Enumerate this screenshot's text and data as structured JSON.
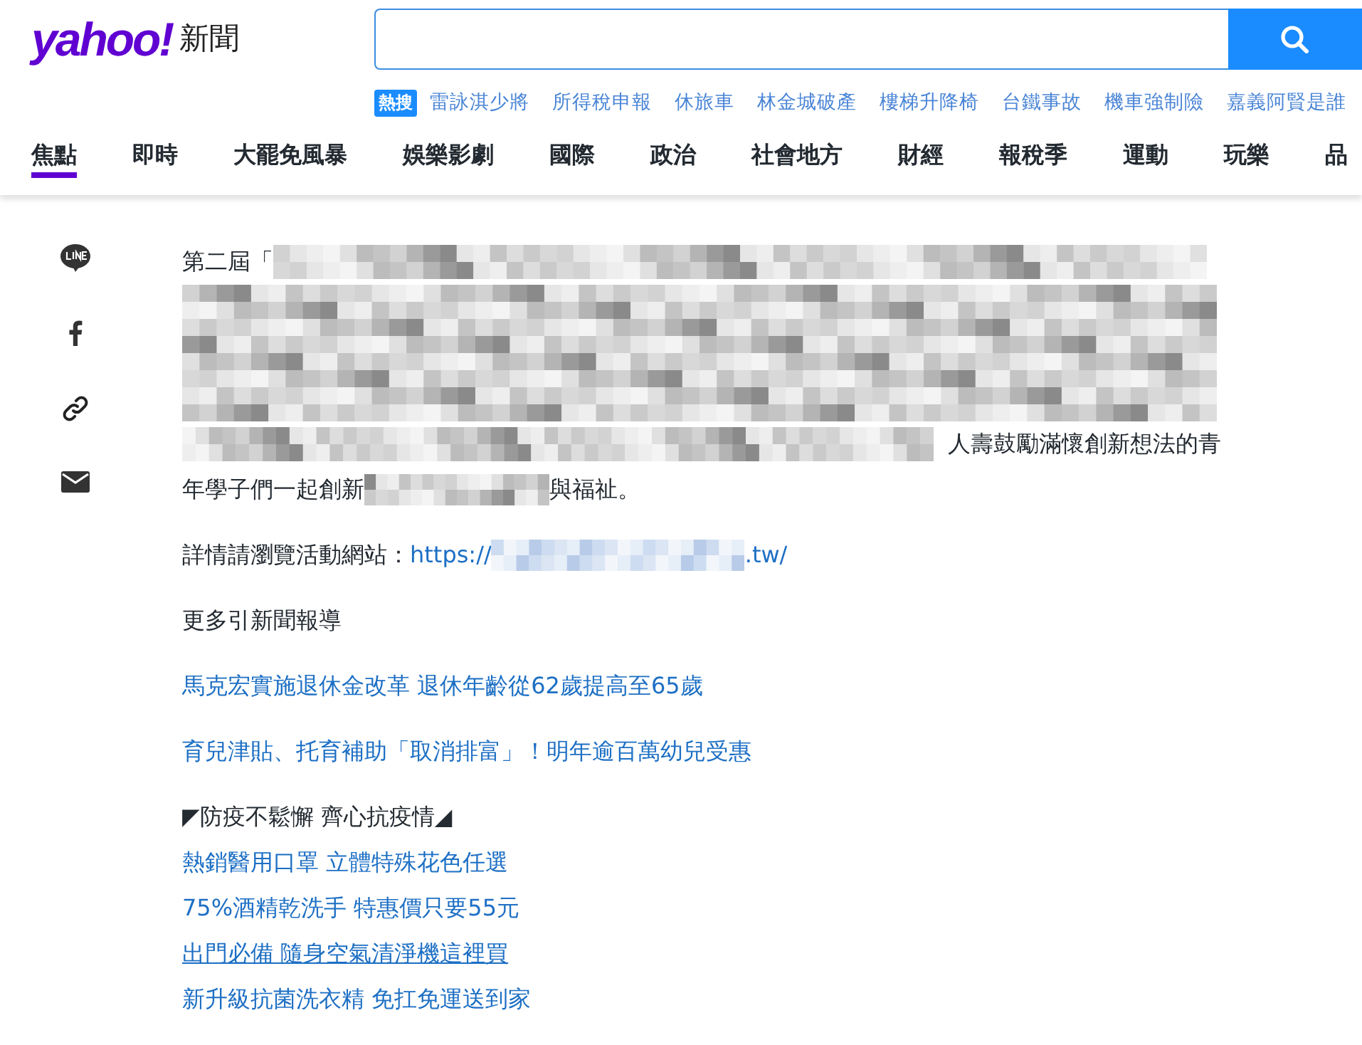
{
  "logo": {
    "brand": "yahoo!",
    "section": "新聞"
  },
  "trending": {
    "label": "熱搜",
    "items": [
      "雷詠淇少將",
      "所得稅申報",
      "休旅車",
      "林金城破產",
      "樓梯升降椅",
      "台鐵事故",
      "機車強制險",
      "嘉義阿賢是誰"
    ]
  },
  "nav": [
    {
      "label": "焦點",
      "selected": true
    },
    {
      "label": "即時",
      "selected": false
    },
    {
      "label": "大罷免風暴",
      "selected": false
    },
    {
      "label": "娛樂影劇",
      "selected": false
    },
    {
      "label": "國際",
      "selected": false
    },
    {
      "label": "政治",
      "selected": false
    },
    {
      "label": "社會地方",
      "selected": false
    },
    {
      "label": "財經",
      "selected": false
    },
    {
      "label": "報稅季",
      "selected": false
    },
    {
      "label": "運動",
      "selected": false
    },
    {
      "label": "玩樂",
      "selected": false
    },
    {
      "label": "品",
      "selected": false
    }
  ],
  "article": {
    "paragraph": [
      {
        "parts": [
          {
            "kind": "text",
            "text": "第二屆「"
          },
          {
            "kind": "mosaic"
          }
        ]
      },
      {
        "parts": [
          {
            "kind": "mosaic_block"
          }
        ]
      },
      {
        "parts": [
          {
            "kind": "mosaic"
          },
          {
            "kind": "text",
            "text": "人壽鼓勵滿懷創新想法的青"
          }
        ]
      },
      {
        "parts": [
          {
            "kind": "text",
            "text": "年學子們一起創新"
          },
          {
            "kind": "mosaic_short"
          },
          {
            "kind": "text",
            "text": "與福祉。"
          }
        ]
      }
    ],
    "site_line": {
      "label": "詳情請瀏覽活動網站：",
      "url_start": "https://",
      "url_end": ".tw/"
    },
    "more_heading": "更多引新聞報導",
    "related_links": [
      "馬克宏實施退休金改革 退休年齡從62歲提高至65歲",
      "育兒津貼、托育補助「取消排富」！明年逾百萬幼兒受惠"
    ],
    "promo": {
      "heading": "◤防疫不鬆懈 齊心抗疫情◢",
      "links": [
        {
          "text": "熱銷醫用口罩 立體特殊花色任選",
          "underlined": false
        },
        {
          "text": "75%酒精乾洗手 特惠價只要55元",
          "underlined": false
        },
        {
          "text": "出門必備 隨身空氣清淨機這裡買",
          "underlined": true
        },
        {
          "text": "新升級抗菌洗衣精 免扛免運送到家",
          "underlined": false
        }
      ]
    }
  }
}
